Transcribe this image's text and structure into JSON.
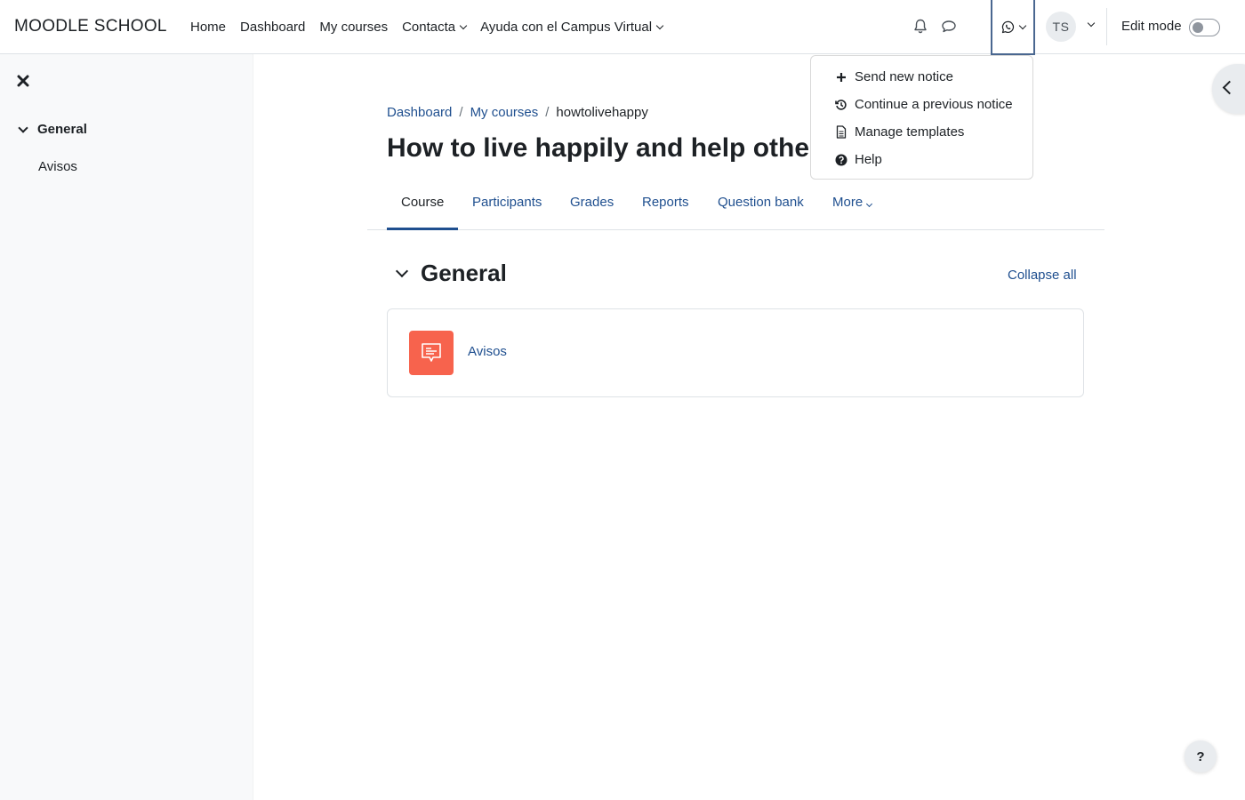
{
  "navbar": {
    "brand": "MOODLE SCHOOL",
    "items": [
      {
        "label": "Home",
        "has_caret": false
      },
      {
        "label": "Dashboard",
        "has_caret": false
      },
      {
        "label": "My courses",
        "has_caret": false
      },
      {
        "label": "Contacta",
        "has_caret": true
      },
      {
        "label": "Ayuda con el Campus Virtual",
        "has_caret": true
      }
    ],
    "icons": [
      "bell-icon",
      "chat-bubble-icon",
      "whatsapp-icon"
    ],
    "user_initials": "TS",
    "edit_mode_label": "Edit mode",
    "edit_mode_on": false
  },
  "notice_menu": {
    "items": [
      {
        "icon": "plus-icon",
        "label": "Send new notice"
      },
      {
        "icon": "history-icon",
        "label": "Continue a previous notice"
      },
      {
        "icon": "document-icon",
        "label": "Manage templates"
      },
      {
        "icon": "question-circle-icon",
        "label": "Help"
      }
    ]
  },
  "drawer": {
    "section": "General",
    "items": [
      "Avisos"
    ]
  },
  "breadcrumb": {
    "items": [
      "Dashboard",
      "My courses"
    ],
    "current": "howtolivehappy"
  },
  "page": {
    "title": "How to live happily and help other"
  },
  "tabs": [
    "Course",
    "Participants",
    "Grades",
    "Reports",
    "Question bank",
    "More"
  ],
  "section": {
    "title": "General",
    "collapse_all": "Collapse all"
  },
  "activity": {
    "name": "Avisos",
    "icon_color": "#f7634d"
  },
  "help_fab": "?",
  "colors": {
    "link": "#1f4f8f",
    "text": "#1d2125",
    "drawer_bg": "#f8f9fa",
    "forum_icon": "#f7634d"
  }
}
